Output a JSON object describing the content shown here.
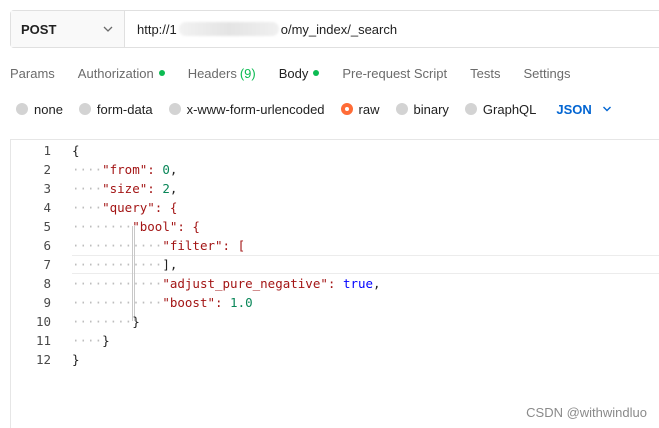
{
  "request": {
    "method": "POST",
    "url_prefix": "http://1",
    "url_suffix": "o/my_index/_search"
  },
  "tabs": [
    {
      "label": "Params"
    },
    {
      "label": "Authorization",
      "dot": true
    },
    {
      "label": "Headers",
      "count": "(9)"
    },
    {
      "label": "Body",
      "dot": true,
      "active": true
    },
    {
      "label": "Pre-request Script"
    },
    {
      "label": "Tests"
    },
    {
      "label": "Settings"
    }
  ],
  "body_types": [
    {
      "label": "none"
    },
    {
      "label": "form-data"
    },
    {
      "label": "x-www-form-urlencoded"
    },
    {
      "label": "raw",
      "selected": true
    },
    {
      "label": "binary"
    },
    {
      "label": "GraphQL"
    }
  ],
  "format": "JSON",
  "editor": {
    "lines": [
      {
        "num": "1",
        "text": "{"
      },
      {
        "num": "2",
        "text": "\"from\": 0,"
      },
      {
        "num": "3",
        "text": "\"size\": 2,"
      },
      {
        "num": "4",
        "text": "\"query\": {"
      },
      {
        "num": "5",
        "text": "\"bool\": {"
      },
      {
        "num": "6",
        "text": "\"filter\": ["
      },
      {
        "num": "7",
        "text": "],"
      },
      {
        "num": "8",
        "text": "\"adjust_pure_negative\": true,"
      },
      {
        "num": "9",
        "text": "\"boost\": 1.0"
      },
      {
        "num": "10",
        "text": "}"
      },
      {
        "num": "11",
        "text": "}"
      },
      {
        "num": "12",
        "text": "}"
      }
    ]
  },
  "watermark": "CSDN @withwindluo",
  "colors": {
    "accent": "#ff6c37",
    "status_dot": "#0cbb52",
    "link": "#0265d2"
  }
}
